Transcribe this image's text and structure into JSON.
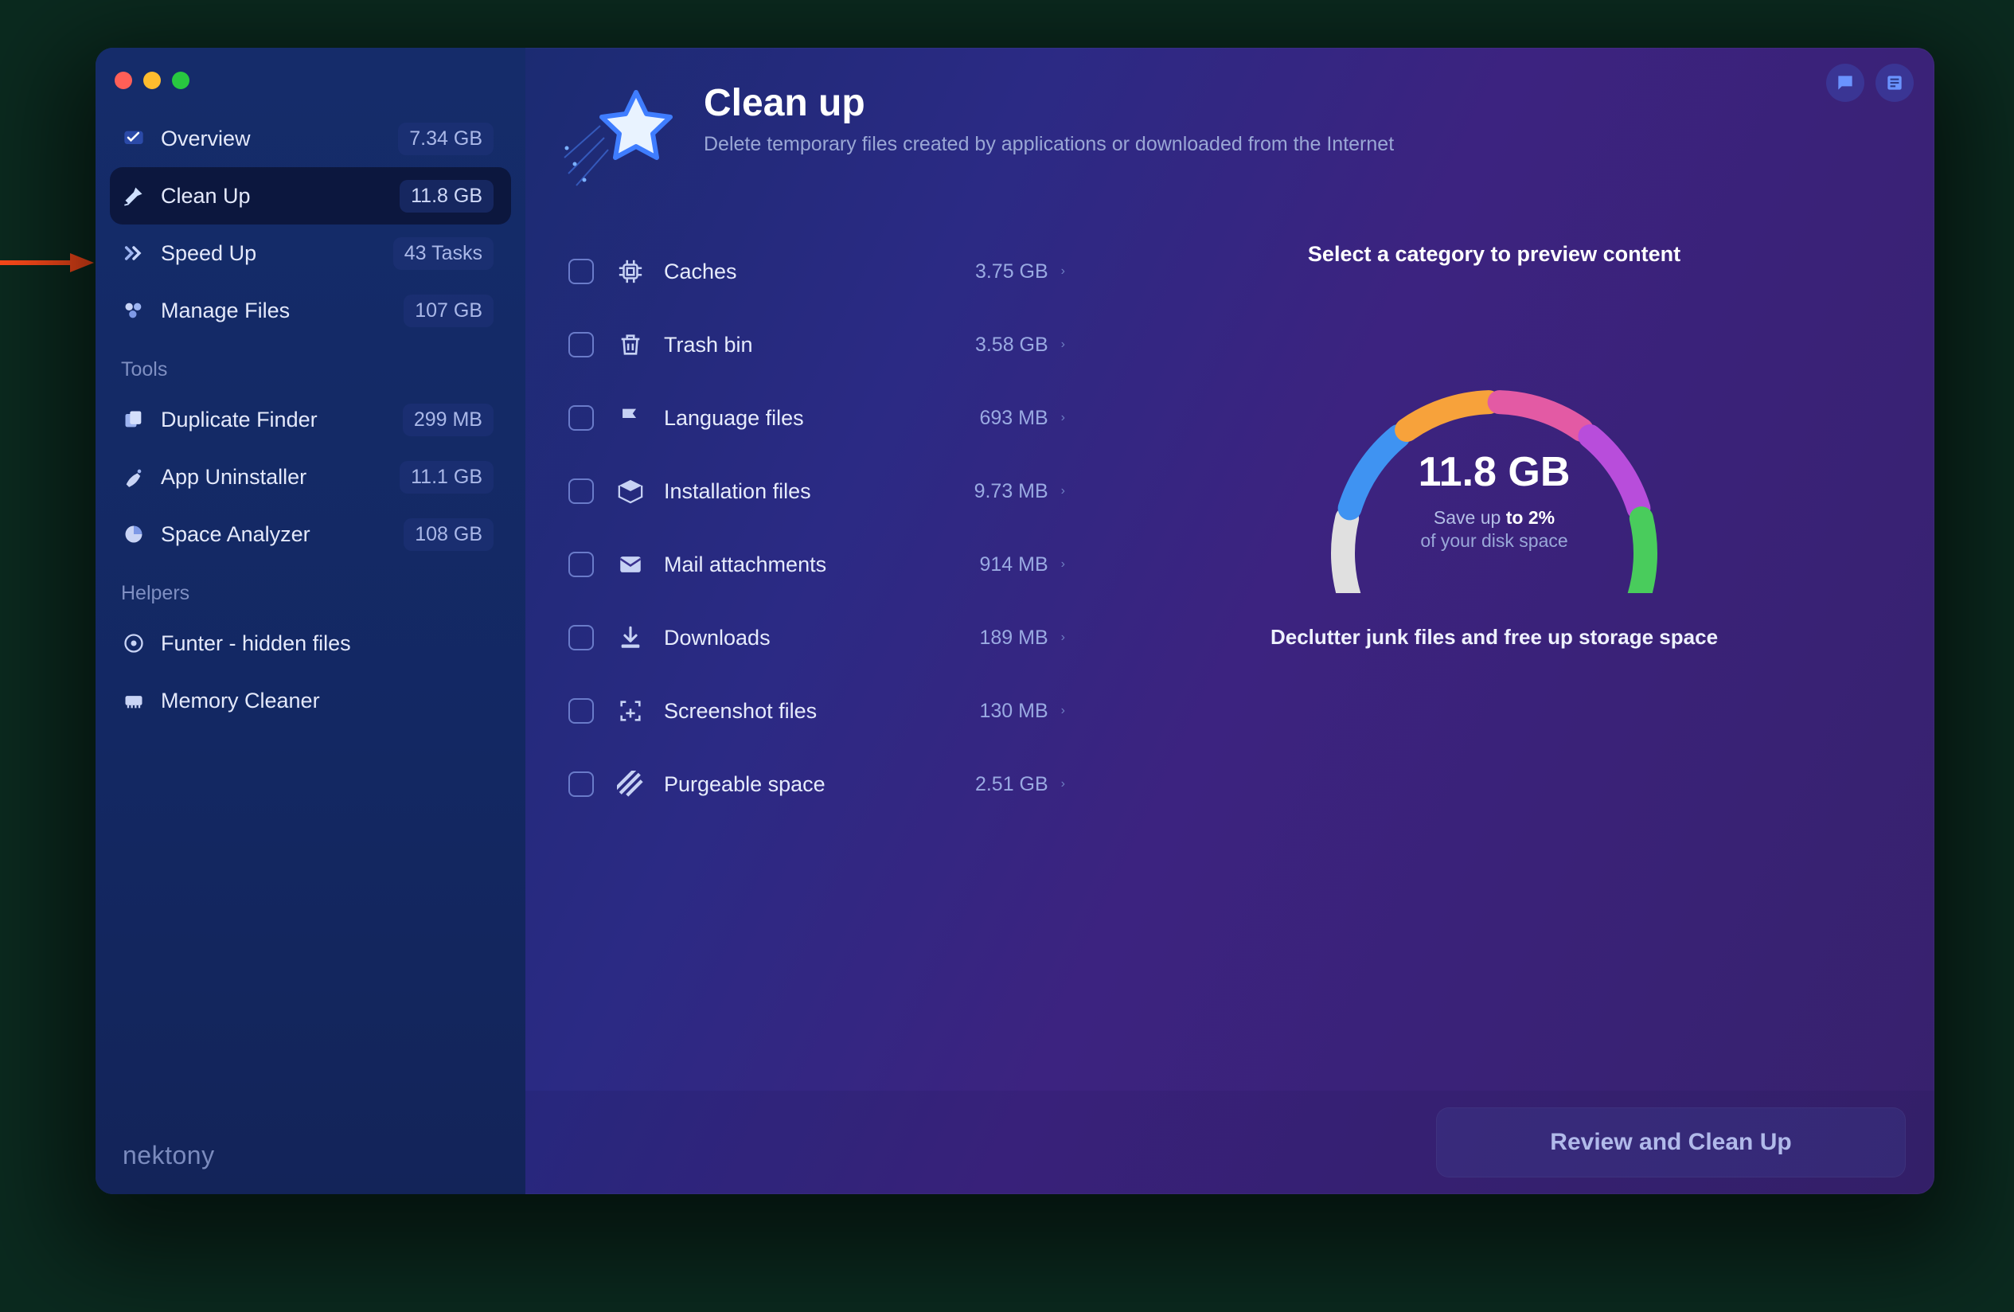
{
  "brand": "nektony",
  "sidebar": {
    "items": [
      {
        "label": "Overview",
        "badge": "7.34 GB"
      },
      {
        "label": "Clean Up",
        "badge": "11.8 GB"
      },
      {
        "label": "Speed Up",
        "badge": "43 Tasks"
      },
      {
        "label": "Manage Files",
        "badge": "107 GB"
      }
    ],
    "tools_label": "Tools",
    "tools": [
      {
        "label": "Duplicate Finder",
        "badge": "299 MB"
      },
      {
        "label": "App Uninstaller",
        "badge": "11.1 GB"
      },
      {
        "label": "Space Analyzer",
        "badge": "108 GB"
      }
    ],
    "helpers_label": "Helpers",
    "helpers": [
      {
        "label": "Funter - hidden files"
      },
      {
        "label": "Memory Cleaner"
      }
    ]
  },
  "hero": {
    "title": "Clean up",
    "subtitle": "Delete temporary files created by applications or downloaded from the Internet"
  },
  "categories": [
    {
      "label": "Caches",
      "size": "3.75 GB"
    },
    {
      "label": "Trash bin",
      "size": "3.58 GB"
    },
    {
      "label": "Language files",
      "size": "693 MB"
    },
    {
      "label": "Installation files",
      "size": "9.73 MB"
    },
    {
      "label": "Mail attachments",
      "size": "914 MB"
    },
    {
      "label": "Downloads",
      "size": "189 MB"
    },
    {
      "label": "Screenshot files",
      "size": "130 MB"
    },
    {
      "label": "Purgeable space",
      "size": "2.51 GB"
    }
  ],
  "preview": {
    "hint": "Select a category to preview content",
    "total": "11.8 GB",
    "saveup_prefix": "Save up ",
    "saveup_bold": "to 2%",
    "saveup_line2": "of your disk space",
    "tagline": "Declutter junk files and free up storage space",
    "gauge_colors": [
      "#e0e0e0",
      "#3f93f2",
      "#f7a23b",
      "#e35aa4",
      "#b84ddb",
      "#49cc5c"
    ]
  },
  "footer": {
    "review_button": "Review and Clean Up"
  }
}
